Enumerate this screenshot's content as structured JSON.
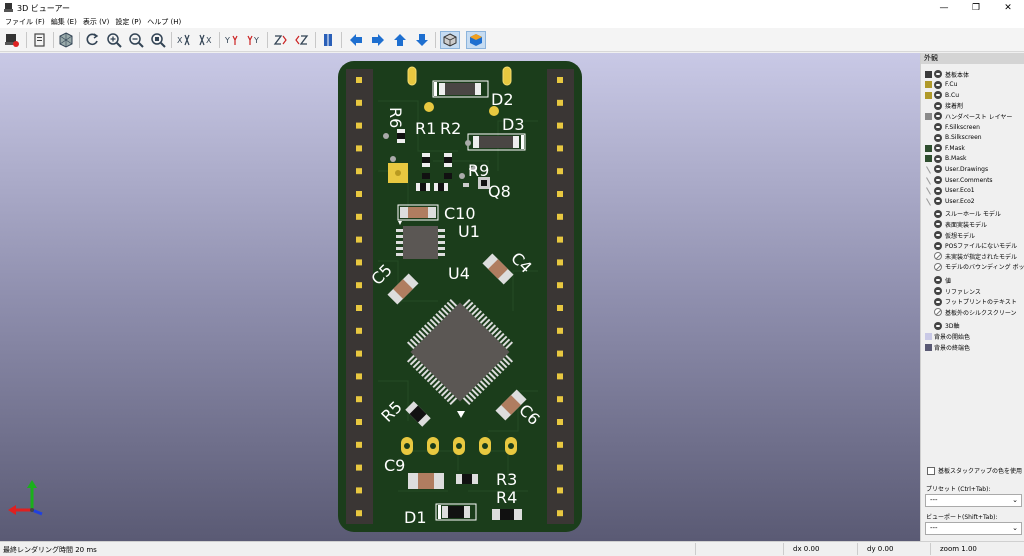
{
  "window": {
    "title": "3D ビューアー",
    "minimize": "—",
    "maximize": "❐",
    "close": "✕"
  },
  "menu": [
    "ファイル (F)",
    "編集 (E)",
    "表示 (V)",
    "設定 (P)",
    "ヘルプ (H)"
  ],
  "pcb": {
    "refs": {
      "r6": "R6",
      "d2": "D2",
      "r1": "R1",
      "r2": "R2",
      "d3": "D3",
      "r9": "R9",
      "q8": "Q8",
      "c10": "C10",
      "u1": "U1",
      "c5": "C5",
      "c4": "C4",
      "u4": "U4",
      "r5": "R5",
      "c6": "C6",
      "c9": "C9",
      "r3": "R3",
      "r4": "R4",
      "d1": "D1"
    },
    "colors": {
      "board": "#1b3d1b",
      "header": "#3a3634",
      "pad": "#e8c840",
      "silk": "#ffffff",
      "ic": "#5b5754"
    }
  },
  "panel": {
    "title": "外観",
    "layers": [
      {
        "label": "基板本体",
        "color": "#3a3a3a",
        "eye": "on"
      },
      {
        "label": "F.Cu",
        "color": "#b09a2a",
        "eye": "on"
      },
      {
        "label": "B.Cu",
        "color": "#b09a2a",
        "eye": "on"
      },
      {
        "label": "接着剤",
        "color": "",
        "eye": "on"
      },
      {
        "label": "ハンダペースト レイヤー",
        "color": "#8a8a8a",
        "eye": "on"
      },
      {
        "label": "F.Silkscreen",
        "color": "",
        "eye": "on"
      },
      {
        "label": "B.Silkscreen",
        "color": "",
        "eye": "on"
      },
      {
        "label": "F.Mask",
        "color": "#2e4e2e",
        "eye": "on"
      },
      {
        "label": "B.Mask",
        "color": "#2e4e2e",
        "eye": "on"
      },
      {
        "label": "User.Drawings",
        "color": "slash",
        "eye": "on"
      },
      {
        "label": "User.Comments",
        "color": "slash",
        "eye": "on"
      },
      {
        "label": "User.Eco1",
        "color": "slash",
        "eye": "on"
      },
      {
        "label": "User.Eco2",
        "color": "slash",
        "eye": "on"
      }
    ],
    "models": [
      {
        "label": "スルーホール モデル",
        "eye": "on"
      },
      {
        "label": "表面実装モデル",
        "eye": "on"
      },
      {
        "label": "仮想モデル",
        "eye": "on"
      },
      {
        "label": "POSファイルにないモデル",
        "eye": "on"
      },
      {
        "label": "未実装が指定されたモデル",
        "eye": "off"
      },
      {
        "label": "モデルのバウンディング ボックス",
        "eye": "off"
      }
    ],
    "texts": [
      {
        "label": "値",
        "eye": "on"
      },
      {
        "label": "リファレンス",
        "eye": "on"
      },
      {
        "label": "フットプリントのテキスト",
        "eye": "on"
      },
      {
        "label": "基板外のシルクスクリーン",
        "eye": "off"
      }
    ],
    "extras": [
      {
        "label": "3D軸",
        "color": "",
        "eye": "on"
      },
      {
        "label": "背景の開始色",
        "color": "#c9c9e6",
        "eye": "none"
      },
      {
        "label": "背景の終端色",
        "color": "#5a5a74",
        "eye": "none"
      }
    ],
    "stackup_label": "基板スタックアップの色を使用",
    "preset_label": "プリセット (Ctrl+Tab):",
    "preset_value": "---",
    "viewport_label": "ビューポート(Shift+Tab):",
    "viewport_value": "---"
  },
  "status": {
    "render_time": "最終レンダリング時間 20 ms",
    "dx": "dx 0.00",
    "dy": "dy 0.00",
    "zoom": "zoom 1.00"
  }
}
